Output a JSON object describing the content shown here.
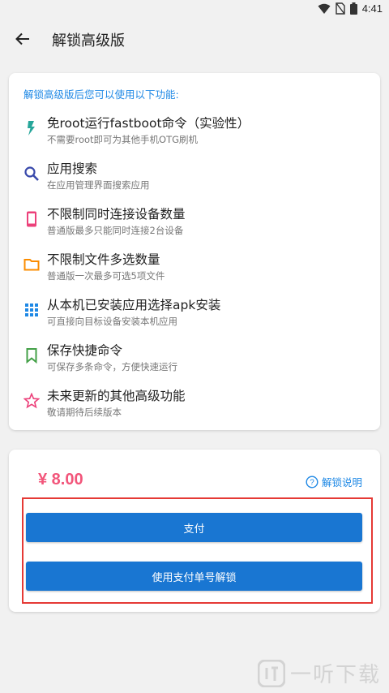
{
  "status_bar": {
    "time": "4:41",
    "icons": [
      "wifi-icon",
      "no-sim-icon",
      "battery-icon"
    ]
  },
  "app_bar": {
    "back_icon": "arrow-back-icon",
    "title": "解锁高级版"
  },
  "features": {
    "header": "解锁高级版后您可以使用以下功能:",
    "items": [
      {
        "icon": "flash-icon",
        "color": "#26a69a",
        "title": "免root运行fastboot命令（实验性）",
        "desc": "不需要root即可为其他手机OTG刷机"
      },
      {
        "icon": "search-icon",
        "color": "#3949ab",
        "title": "应用搜索",
        "desc": "在应用管理界面搜索应用"
      },
      {
        "icon": "phone-icon",
        "color": "#ec407a",
        "title": "不限制同时连接设备数量",
        "desc": "普通版最多只能同时连接2台设备"
      },
      {
        "icon": "folder-icon",
        "color": "#fb8c00",
        "title": "不限制文件多选数量",
        "desc": "普通版一次最多可选5项文件"
      },
      {
        "icon": "apps-grid-icon",
        "color": "#1e88e5",
        "title": "从本机已安装应用选择apk安装",
        "desc": "可直接向目标设备安装本机应用"
      },
      {
        "icon": "bookmark-icon",
        "color": "#43a047",
        "title": "保存快捷命令",
        "desc": "可保存多条命令，方便快速运行"
      },
      {
        "icon": "star-icon",
        "color": "#ec407a",
        "title": "未来更新的其他高级功能",
        "desc": "敬请期待后续版本"
      }
    ]
  },
  "payment": {
    "price": "¥ 8.00",
    "help_label": "解锁说明",
    "pay_button": "支付",
    "order_button": "使用支付单号解锁"
  },
  "watermark": {
    "text": "一听下载"
  },
  "colors": {
    "accent": "#1e88e5",
    "button": "#1976d2",
    "price": "#f2557a",
    "highlight": "#e53935"
  }
}
